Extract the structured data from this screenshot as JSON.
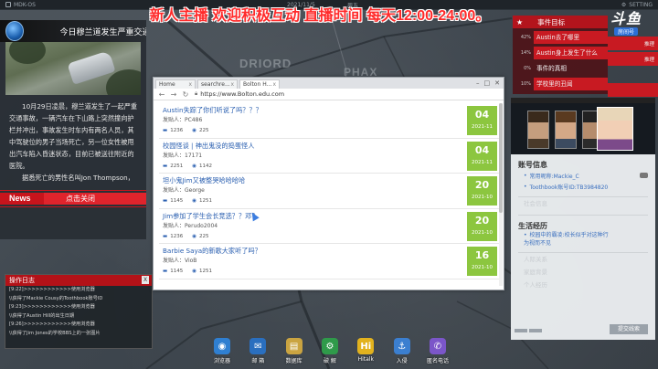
{
  "topbar": {
    "os_name": "MDK-OS",
    "date": "2021/11/5",
    "net": "周五",
    "setting_label": "SETTING"
  },
  "banner": "新人主播 欢迎积极互动 直播时间 每天12:00-24:00。",
  "map_labels": [
    "DRIORD",
    "PHAX"
  ],
  "news": {
    "headline": "今日穆兰道发生严重交通事",
    "body": [
      "10月29日凌晨，穆兰道发生了一起严重交通事故，一辆汽车在下山路上突然撞向护栏并冲出，事故发生时车内有两名人员，其中驾驶位的男子当场死亡，另一位女性被甩出汽车陷入昏迷状态，目前已被送往附近的医院。",
      "据悉死亡的男性名叫Jon Thompson，"
    ],
    "tag": "News",
    "close": "点击关闭"
  },
  "log": {
    "title": "操作日志",
    "close": "X",
    "lines": [
      "[9:22]>>>>>>>>>>>>使用浏览器",
      "\\\\获得了Mackie Cousy的Toothbook账号ID",
      "[9:23]>>>>>>>>>>>>使用浏览器",
      "\\\\获得了Austin Hill的出生日期",
      "[9:26]>>>>>>>>>>>>使用浏览器",
      "\\\\获得了Jim Jones的学校BBS上的一张图片"
    ]
  },
  "browser": {
    "tabs": [
      "Home",
      "searchre...",
      "Bolton H..."
    ],
    "tab_close": "x",
    "url": "https://www.Bolton.edu.com",
    "posts": [
      {
        "title": "Austin失踪了你们听说了吗？？？",
        "author": "发贴人：PC486",
        "comments": "1236",
        "views": "225",
        "day": "04",
        "month": "2021-11"
      },
      {
        "title": "校园怪谈 | 神出鬼没的捣蛋怪人",
        "author": "发贴人：17171",
        "comments": "2251",
        "views": "1142",
        "day": "04",
        "month": "2021-11"
      },
      {
        "title": "坦小鬼Jim又被整哭哈哈哈哈",
        "author": "发贴人：George",
        "comments": "1145",
        "views": "1251",
        "day": "20",
        "month": "2021-10"
      },
      {
        "title": "Jim参加了学生会长竞选？？邓？",
        "author": "发贴人：Perudo2004",
        "comments": "1236",
        "views": "225",
        "day": "20",
        "month": "2021-10"
      },
      {
        "title": "Barbie Saya的新歌大家听了吗？",
        "author": "发贴人：VioB",
        "comments": "1145",
        "views": "1251",
        "day": "16",
        "month": "2021-10"
      }
    ]
  },
  "logo": {
    "big": "斗鱼",
    "small": "房间号",
    "room": "888661"
  },
  "tasks": {
    "title": "事件目标",
    "items": [
      {
        "pct": "42%",
        "label": "Austin去了哪里",
        "side": "推理",
        "hot": true
      },
      {
        "pct": "14%",
        "label": "Austin身上发生了什么",
        "side": "推理",
        "hot": true
      },
      {
        "pct": "0%",
        "label": "事件的真相",
        "side": "",
        "hot": false
      },
      {
        "pct": "10%",
        "label": "学校里的丑闻",
        "side": "",
        "hot": true
      }
    ]
  },
  "profile": {
    "account_title": "账号信息",
    "accounts": [
      "常用昵称:Mackie_C",
      "Toothbook账号ID:TB3984820"
    ],
    "ghost1": "社会信息",
    "life_title": "生活经历",
    "exp_lines": [
      "校园中的霸凌:校长似乎对这种行",
      "为视而不见"
    ],
    "ghost_lines": [
      "人际关系",
      "家庭背景",
      "个人经历"
    ],
    "button": "提交线索"
  },
  "dock": [
    {
      "icon": "browser-icon",
      "label": "浏览器",
      "color": "#2f7fd1",
      "glyph": "◉"
    },
    {
      "icon": "mail-icon",
      "label": "邮 箱",
      "color": "#2a6fbf",
      "glyph": "✉"
    },
    {
      "icon": "database-icon",
      "label": "数据库",
      "color": "#caa441",
      "glyph": "▤"
    },
    {
      "icon": "crack-icon",
      "label": "破 解",
      "color": "#2f9a4a",
      "glyph": "⚙"
    },
    {
      "icon": "hitalk-icon",
      "label": "Hitalk",
      "color": "#e2b21e",
      "glyph": "Hi"
    },
    {
      "icon": "intrude-icon",
      "label": "入侵",
      "color": "#3b7fd0",
      "glyph": "⚓"
    },
    {
      "icon": "phone-icon",
      "label": "匿名电话",
      "color": "#7b56c9",
      "glyph": "✆"
    }
  ]
}
